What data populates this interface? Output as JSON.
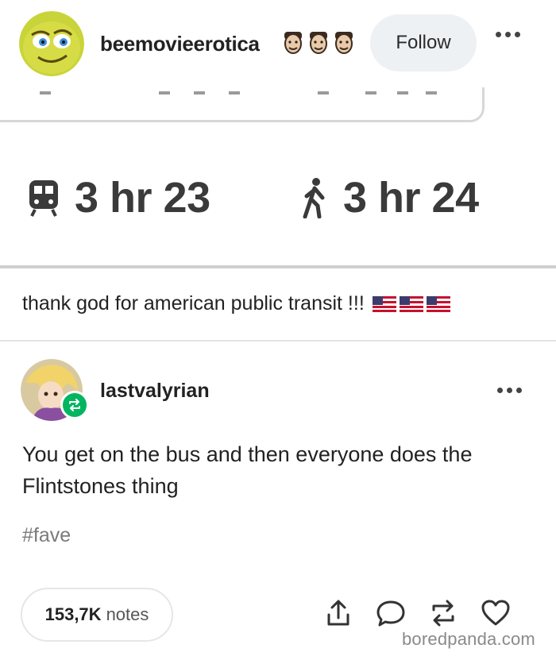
{
  "post": {
    "username": "beemovieerotica",
    "follow_label": "Follow",
    "emoji_icons": [
      "face-emoji-icon",
      "face-emoji-icon",
      "face-emoji-icon"
    ]
  },
  "map_screenshot": {
    "transit_time": "3 hr 23",
    "walk_time": "3 hr 24"
  },
  "caption": {
    "text": "thank god for american public transit !!!",
    "flag_icons": [
      "us-flag-icon",
      "us-flag-icon",
      "us-flag-icon"
    ]
  },
  "reblog": {
    "username": "lastvalyrian",
    "text": "You get on the bus and then everyone does the Flintstones thing",
    "tag": "#fave"
  },
  "footer": {
    "notes_count": "153,7K",
    "notes_label": "notes",
    "icons": [
      "share-icon",
      "comment-icon",
      "reblog-icon",
      "heart-icon"
    ]
  },
  "watermark": "boredpanda.com",
  "colors": {
    "reblog_badge": "#00b560",
    "follow_bg": "#eef1f4"
  }
}
